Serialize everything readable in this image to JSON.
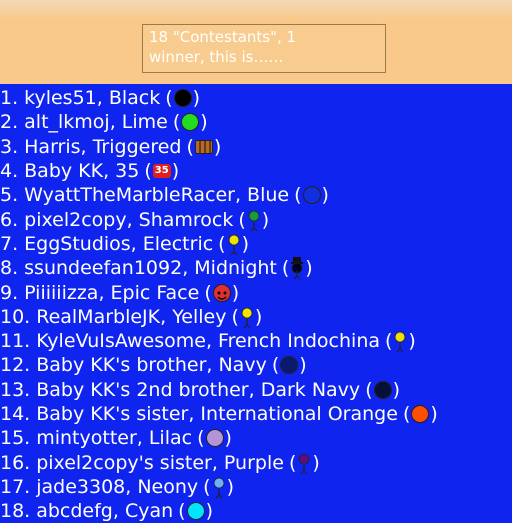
{
  "header": {
    "line1": "18 \"Contestants\", 1",
    "line2": "winner, this is……"
  },
  "contestants": [
    {
      "num": "1.",
      "text": "kyles51, Black",
      "icon": "black-marble-icon",
      "color": "#000000"
    },
    {
      "num": "2.",
      "text": "alt_lkmoj, Lime",
      "icon": "lime-marble-icon",
      "color": "#22dd22"
    },
    {
      "num": "3.",
      "text": "Harris, Triggered",
      "icon": "triggered-marble-icon",
      "color": "#b26a2e"
    },
    {
      "num": "4.",
      "text": "Baby KK, 35",
      "icon": "35-badge-icon",
      "color": "#e02020",
      "badge": "35"
    },
    {
      "num": "5.",
      "text": "WyattTheMarbleRacer, Blue",
      "icon": "blue-marble-icon",
      "color": "#1030e0"
    },
    {
      "num": "6.",
      "text": "pixel2copy, Shamrock",
      "icon": "shamrock-figure-icon",
      "color": "#1a9a3a"
    },
    {
      "num": "7.",
      "text": "EggStudios, Electric",
      "icon": "electric-figure-icon",
      "color": "#f0e000"
    },
    {
      "num": "8.",
      "text": "ssundeefan1092, Midnight",
      "icon": "midnight-tophat-figure-icon",
      "color": "#000022"
    },
    {
      "num": "9.",
      "text": "Piiiiiizza, Epic Face",
      "icon": "epic-face-marble-icon",
      "color": "#e03030"
    },
    {
      "num": "10.",
      "text": "RealMarbleJK, Yelley",
      "icon": "yelley-figure-icon",
      "color": "#f2e600"
    },
    {
      "num": "11.",
      "text": "KyleVuIsAwesome, French Indochina",
      "icon": "french-indochina-figure-icon",
      "color": "#f0e000"
    },
    {
      "num": "12.",
      "text": "Baby KK's brother, Navy",
      "icon": "navy-marble-icon",
      "color": "#0a1a70"
    },
    {
      "num": "13.",
      "text": "Baby KK's 2nd brother, Dark Navy",
      "icon": "dark-navy-marble-icon",
      "color": "#071038"
    },
    {
      "num": "14.",
      "text": "Baby KK's sister, International Orange",
      "icon": "international-orange-marble-icon",
      "color": "#ff4f00"
    },
    {
      "num": "15.",
      "text": "mintyotter, Lilac",
      "icon": "lilac-marble-icon",
      "color": "#b394d6"
    },
    {
      "num": "16.",
      "text": "pixel2copy's sister, Purple",
      "icon": "purple-figure-icon",
      "color": "#5a1080"
    },
    {
      "num": "17.",
      "text": "jade3308, Neony",
      "icon": "neony-figure-icon",
      "color": "#6ab0ff"
    },
    {
      "num": "18.",
      "text": "abcdefg, Cyan",
      "icon": "cyan-marble-icon",
      "color": "#00e5ff"
    }
  ]
}
